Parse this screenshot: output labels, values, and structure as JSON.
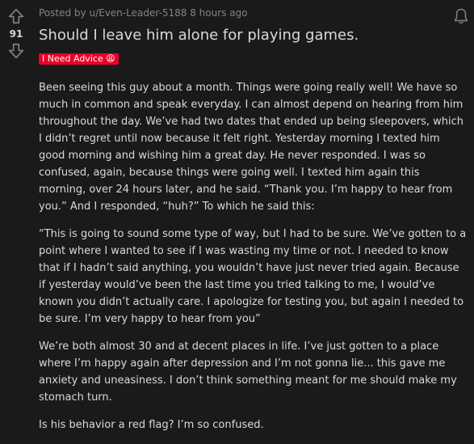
{
  "vote": {
    "score": "91"
  },
  "post": {
    "meta_prefix": "Posted by",
    "author": "u/Even-Leader-5188",
    "time": "8 hours ago",
    "title": "Should I leave him alone for playing games.",
    "flair": "I Need Advice 😩",
    "flair_color": "#ea0027",
    "paragraphs": [
      "Been seeing this guy about a month. Things were going really well! We have so much in common and speak everyday. I can almost depend on hearing from him throughout the day. We’ve had two dates that ended up being sleepovers, which I didn’t regret until now because it felt right. Yesterday morning I texted him good morning and wishing him a great day. He never responded. I was so confused, again, because things were going well. I texted him again this morning, over 24 hours later, and he said. “Thank you. I’m happy to hear from you.” And I responded, “huh?” To which he said this:",
      "“This is going to sound some type of way, but I had to be sure. We’ve gotten to a point where I wanted to see if I was wasting my time or not. I needed to know that if I hadn’t said anything, you wouldn’t have just never tried again. Because if yesterday would’ve been the last time you tried talking to me, I would’ve known you didn’t actually care. I apologize for testing you, but again I needed to be sure. I’m very happy to hear from you”",
      "We’re both almost 30 and at decent places in life. I’ve just gotten to a place where I’m happy again after depression and I’m not gonna lie... this gave me anxiety and uneasiness. I don’t think something meant for me should make my stomach turn.",
      "Is his behavior a red flag? I’m so confused."
    ]
  },
  "icons": {
    "upvote": "upvote-arrow-icon",
    "downvote": "downvote-arrow-icon",
    "notification": "bell-icon"
  }
}
